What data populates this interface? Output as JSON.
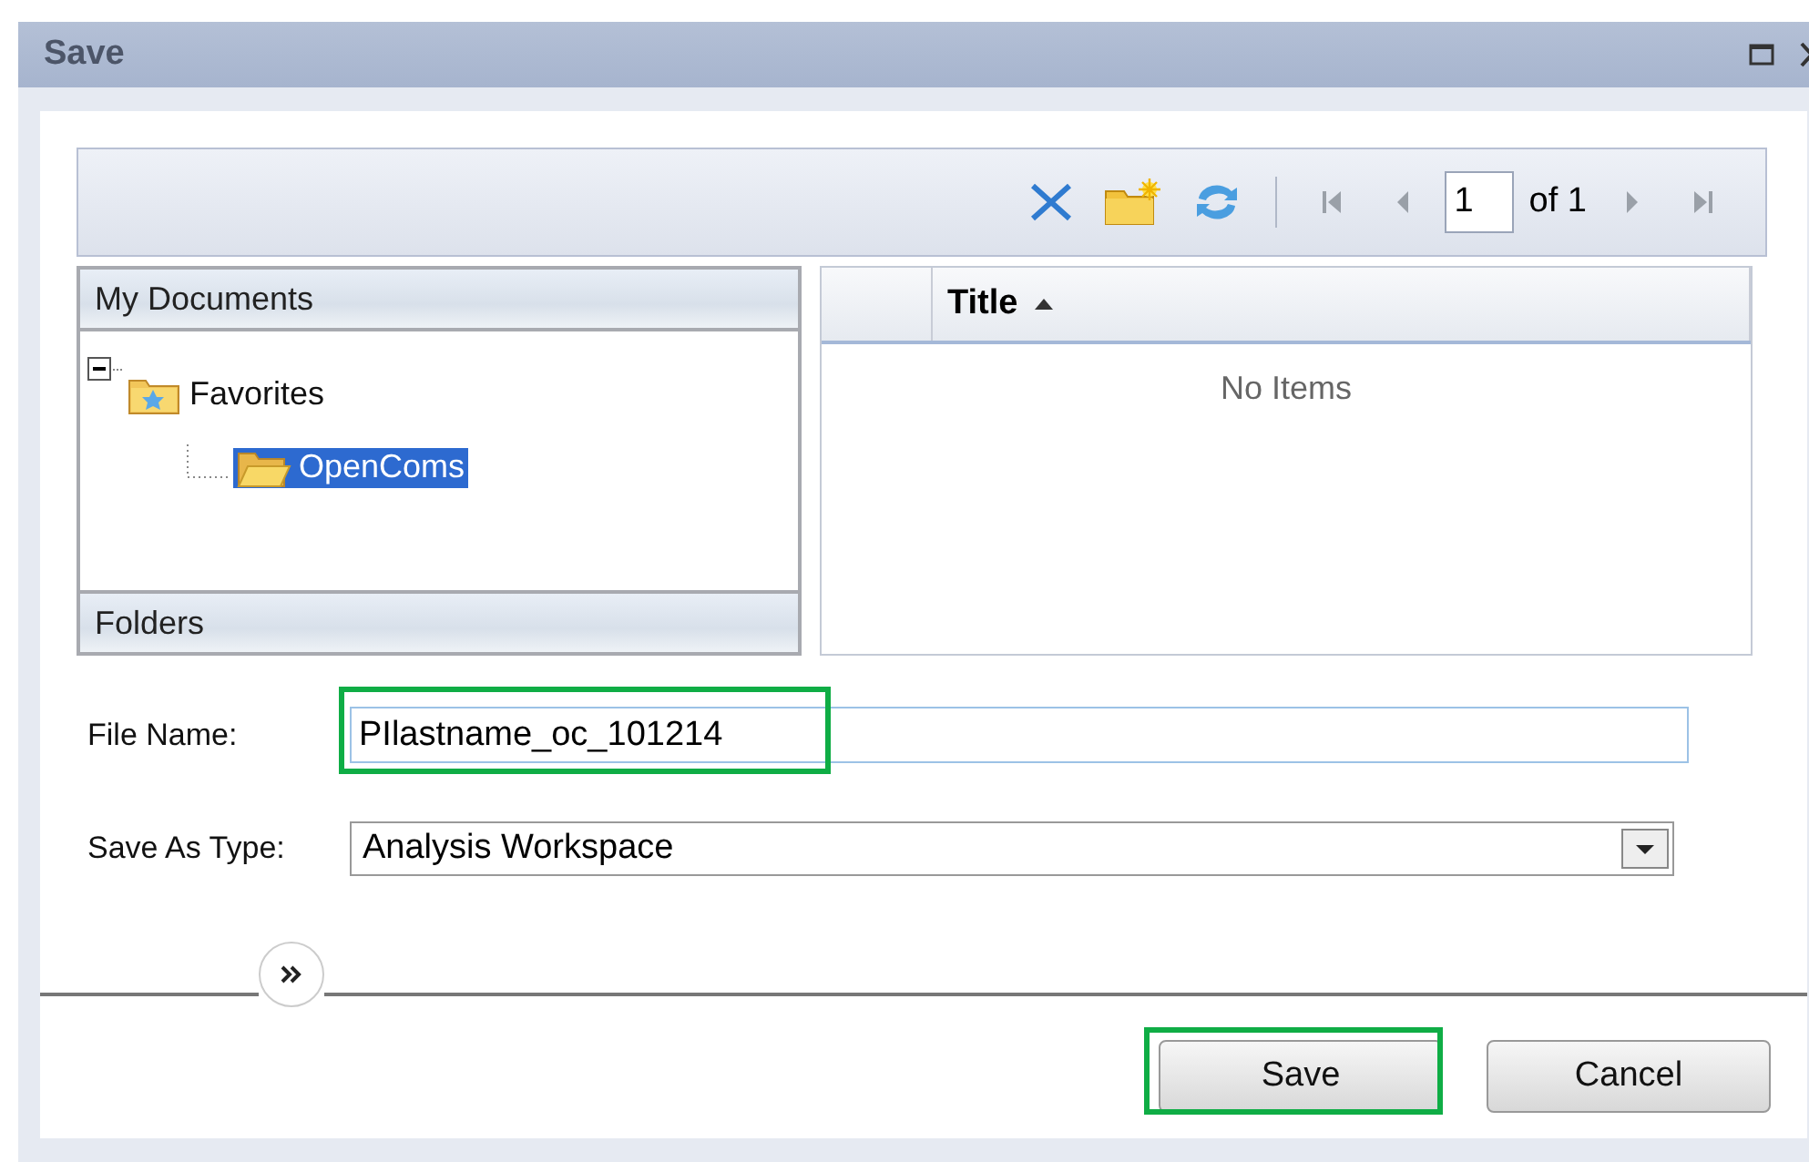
{
  "window": {
    "title": "Save"
  },
  "pager": {
    "page": "1",
    "of": "of 1"
  },
  "folders_panel": {
    "header": "My Documents",
    "footer": "Folders",
    "tree": [
      {
        "label": "Favorites",
        "expanded": true,
        "selected": false,
        "children": [
          {
            "label": "OpenComs",
            "selected": true
          }
        ]
      }
    ]
  },
  "table": {
    "columns": [
      {
        "label": "Title",
        "sort_ascending": true
      }
    ],
    "empty_text": "No Items"
  },
  "file_name": {
    "label": "File Name:",
    "value": "PIlastname_oc_101214",
    "highlighted": true
  },
  "save_as_type": {
    "label": "Save As Type:",
    "value": "Analysis Workspace"
  },
  "buttons": [
    {
      "label": "Save",
      "highlighted": true
    },
    {
      "label": "Cancel",
      "highlighted": false
    }
  ]
}
